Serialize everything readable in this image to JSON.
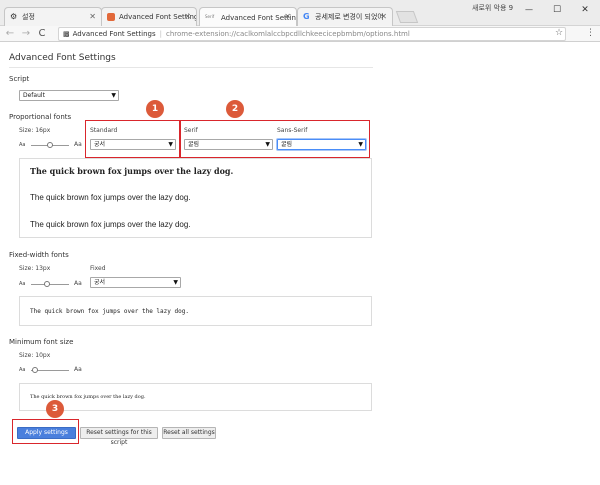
{
  "window": {
    "tabs": [
      {
        "label": "설정"
      },
      {
        "label": "Advanced Font Settings"
      },
      {
        "label": "Advanced Font Settings",
        "prefix": "Serif"
      },
      {
        "label": "공세제로 변경이 되었어"
      }
    ],
    "user": "새로위 악용 9",
    "controls": {
      "minimize": "—",
      "maximize": "☐",
      "close": "✕"
    }
  },
  "toolbar": {
    "back": "←",
    "forward": "→",
    "reload": "C",
    "page_name": "Advanced Font Settings",
    "url": "chrome-extension://caclkomlalccbpcdllchkeecicepbmbm/options.html"
  },
  "page": {
    "title": "Advanced Font Settings",
    "script": {
      "label": "Script",
      "value": "Default"
    },
    "proportional": {
      "label": "Proportional fonts",
      "size_label": "Size: 16px",
      "standard_label": "Standard",
      "standard_value": "궁서",
      "serif_label": "Serif",
      "serif_value": "굴림",
      "sans_label": "Sans-Serif",
      "sans_value": "굴림",
      "slider_small": "Aa",
      "slider_large": "Aa",
      "size_level": 0.5,
      "preview": [
        "The quick brown fox jumps over the lazy dog.",
        "The quick brown fox jumps over the lazy dog.",
        "The quick brown fox jumps over the lazy dog."
      ]
    },
    "fixed": {
      "label": "Fixed-width fonts",
      "size_label": "Size: 13px",
      "font_label": "Fixed",
      "font_value": "궁서",
      "slider_small": "Aa",
      "slider_large": "Aa",
      "size_level": 0.42,
      "preview": "The quick brown fox jumps over the lazy dog."
    },
    "minimum": {
      "label": "Minimum font size",
      "size_label": "Size: 10px",
      "slider_small": "Aa",
      "slider_large": "Aa",
      "size_level": 0.1,
      "preview": "The quick brown fox jumps over the lazy dog."
    },
    "buttons": {
      "apply": "Apply settings",
      "reset_script": "Reset settings for this script",
      "reset_all": "Reset all settings"
    }
  },
  "annotations": [
    "1",
    "2",
    "3"
  ],
  "colors": {
    "accent": "#4a7fdd",
    "annotation": "#dc5a3a",
    "highlight": "#d9262c"
  }
}
